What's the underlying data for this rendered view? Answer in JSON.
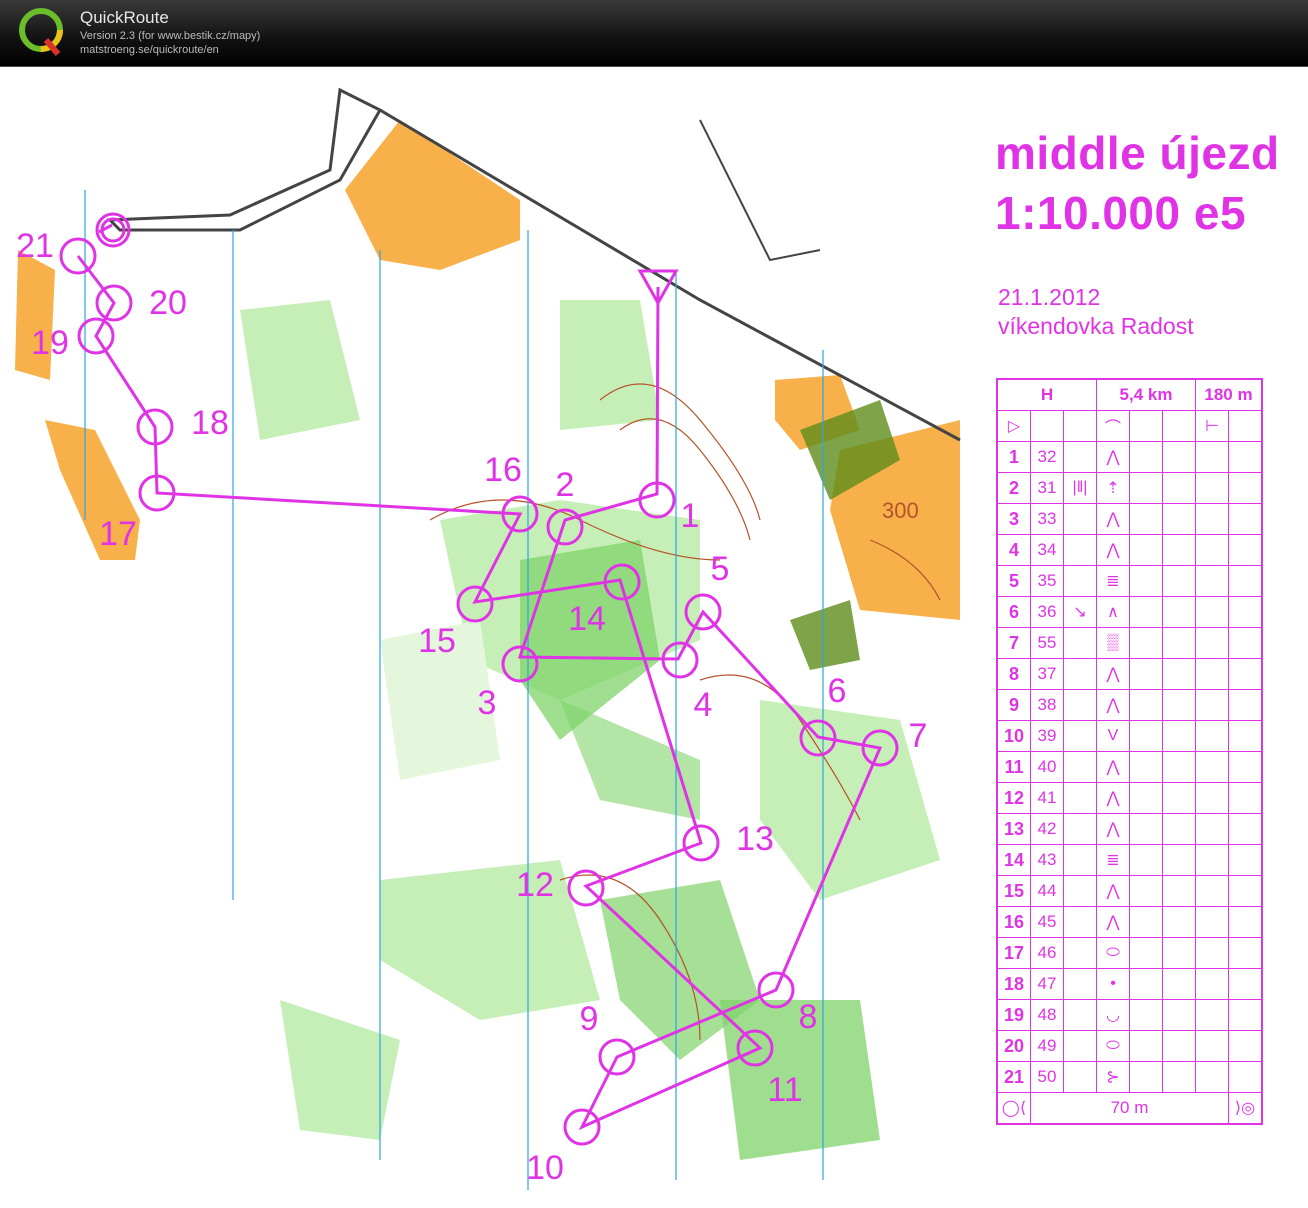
{
  "app": {
    "name": "QuickRoute",
    "version": "Version 2.3  (for www.bestik.cz/mapy)",
    "url": "matstroeng.se/quickroute/en",
    "logo_letter": "Q"
  },
  "map": {
    "title_line1": "middle újezd",
    "title_line2": "1:10.000 e5",
    "date": "21.1.2012",
    "event": "víkendovka Radost",
    "contour_label": "300",
    "course_color": "#e033e6",
    "colors": {
      "forest_green": "#7fd36a",
      "light_green": "#c6efb8",
      "open_yellow": "#f7b04a",
      "contour_brown": "#b5532a",
      "water_blue": "#2aa7e0"
    }
  },
  "controls": [
    {
      "label": "1"
    },
    {
      "label": "2"
    },
    {
      "label": "3"
    },
    {
      "label": "4"
    },
    {
      "label": "5"
    },
    {
      "label": "6"
    },
    {
      "label": "7"
    },
    {
      "label": "8"
    },
    {
      "label": "9"
    },
    {
      "label": "10"
    },
    {
      "label": "11"
    },
    {
      "label": "12"
    },
    {
      "label": "13"
    },
    {
      "label": "14"
    },
    {
      "label": "15"
    },
    {
      "label": "16"
    },
    {
      "label": "17"
    },
    {
      "label": "18"
    },
    {
      "label": "19"
    },
    {
      "label": "20"
    },
    {
      "label": "21"
    }
  ],
  "description_sheet": {
    "class": "H",
    "length": "5,4 km",
    "climb": "180 m",
    "finish_distance": "70 m",
    "rows": [
      {
        "num": "1",
        "code": "32",
        "c": "",
        "d": "⋀"
      },
      {
        "num": "2",
        "code": "31",
        "c": "|‖|",
        "d": "⇡"
      },
      {
        "num": "3",
        "code": "33",
        "c": "",
        "d": "⋀"
      },
      {
        "num": "4",
        "code": "34",
        "c": "",
        "d": "⋀"
      },
      {
        "num": "5",
        "code": "35",
        "c": "",
        "d": "≣"
      },
      {
        "num": "6",
        "code": "36",
        "c": "↘",
        "d": "∧"
      },
      {
        "num": "7",
        "code": "55",
        "c": "",
        "d": "▒"
      },
      {
        "num": "8",
        "code": "37",
        "c": "",
        "d": "⋀"
      },
      {
        "num": "9",
        "code": "38",
        "c": "",
        "d": "⋀"
      },
      {
        "num": "10",
        "code": "39",
        "c": "",
        "d": "V"
      },
      {
        "num": "11",
        "code": "40",
        "c": "",
        "d": "⋀"
      },
      {
        "num": "12",
        "code": "41",
        "c": "",
        "d": "⋀"
      },
      {
        "num": "13",
        "code": "42",
        "c": "",
        "d": "⋀"
      },
      {
        "num": "14",
        "code": "43",
        "c": "",
        "d": "≣"
      },
      {
        "num": "15",
        "code": "44",
        "c": "",
        "d": "⋀"
      },
      {
        "num": "16",
        "code": "45",
        "c": "",
        "d": "⋀"
      },
      {
        "num": "17",
        "code": "46",
        "c": "",
        "d": "⬭"
      },
      {
        "num": "18",
        "code": "47",
        "c": "",
        "d": "•"
      },
      {
        "num": "19",
        "code": "48",
        "c": "",
        "d": "◡"
      },
      {
        "num": "20",
        "code": "49",
        "c": "",
        "d": "⬭"
      },
      {
        "num": "21",
        "code": "50",
        "c": "",
        "d": "⊱"
      }
    ]
  }
}
